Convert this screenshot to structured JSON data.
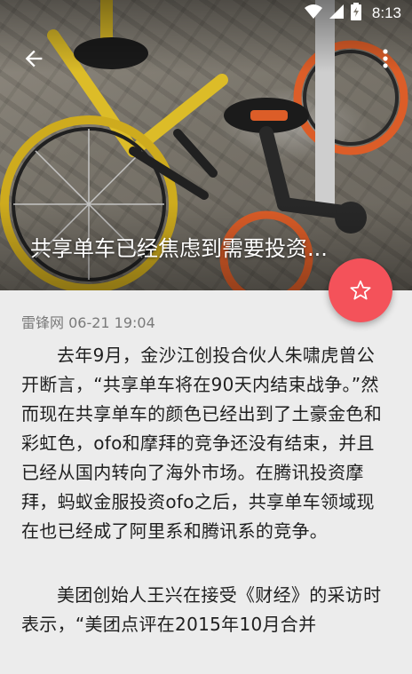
{
  "status_bar": {
    "time": "8:13"
  },
  "hero": {
    "title": "共享单车已经焦虑到需要投资..."
  },
  "meta": {
    "source_time": "雷锋网 06-21 19:04"
  },
  "article": {
    "paragraphs": [
      "去年9月，金沙江创投合伙人朱啸虎曾公开断言，“共享单车将在90天内结束战争。”然而现在共享单车的颜色已经出到了土豪金色和彩虹色，ofo和摩拜的竞争还没有结束，并且已经从国内转向了海外市场。在腾讯投资摩拜，蚂蚁金服投资ofo之后，共享单车领域现在也已经成了阿里系和腾讯系的竞争。",
      "美团创始人王兴在接受《财经》的采访时表示，“美团点评在2015年10月合并"
    ]
  },
  "icons": {
    "wifi": "wifi-icon",
    "signal": "signal-icon",
    "battery": "battery-icon",
    "back": "arrow-back-icon",
    "more": "more-vert-icon",
    "favorite": "star-outline-icon"
  },
  "colors": {
    "fab": "#f4525a",
    "background": "#ececec"
  }
}
